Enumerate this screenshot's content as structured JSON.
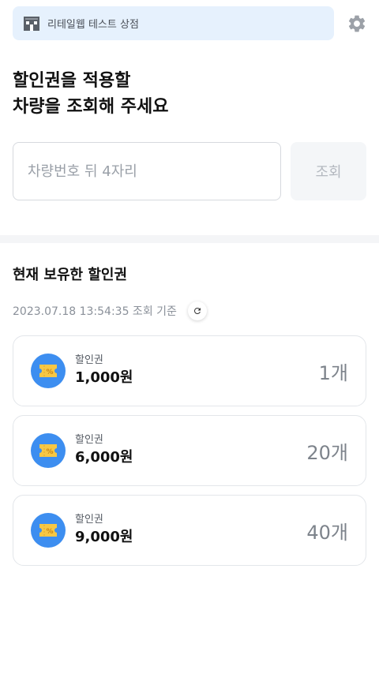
{
  "header": {
    "store_name": "리테일웹 테스트 상점",
    "store_icon": "store-icon",
    "settings_icon": "gear-icon"
  },
  "headline": {
    "line1": "할인권을 적용할",
    "line2": "차량을 조회해 주세요"
  },
  "search": {
    "placeholder": "차량번호 뒤 4자리",
    "value": "",
    "button_label": "조회"
  },
  "coupons_section": {
    "title": "현재 보유한 할인권",
    "timestamp": "2023.07.18 13:54:35 조회 기준",
    "refresh_icon": "refresh-icon",
    "items": [
      {
        "label": "할인권",
        "amount": "1,000원",
        "count": "1개",
        "icon": "coupon-ticket-icon"
      },
      {
        "label": "할인권",
        "amount": "6,000원",
        "count": "20개",
        "icon": "coupon-ticket-icon"
      },
      {
        "label": "할인권",
        "amount": "9,000원",
        "count": "40개",
        "icon": "coupon-ticket-icon"
      }
    ]
  },
  "colors": {
    "accent": "#3d8ef0",
    "ticket": "#f7c744",
    "banner_bg": "#e6f1fd"
  }
}
